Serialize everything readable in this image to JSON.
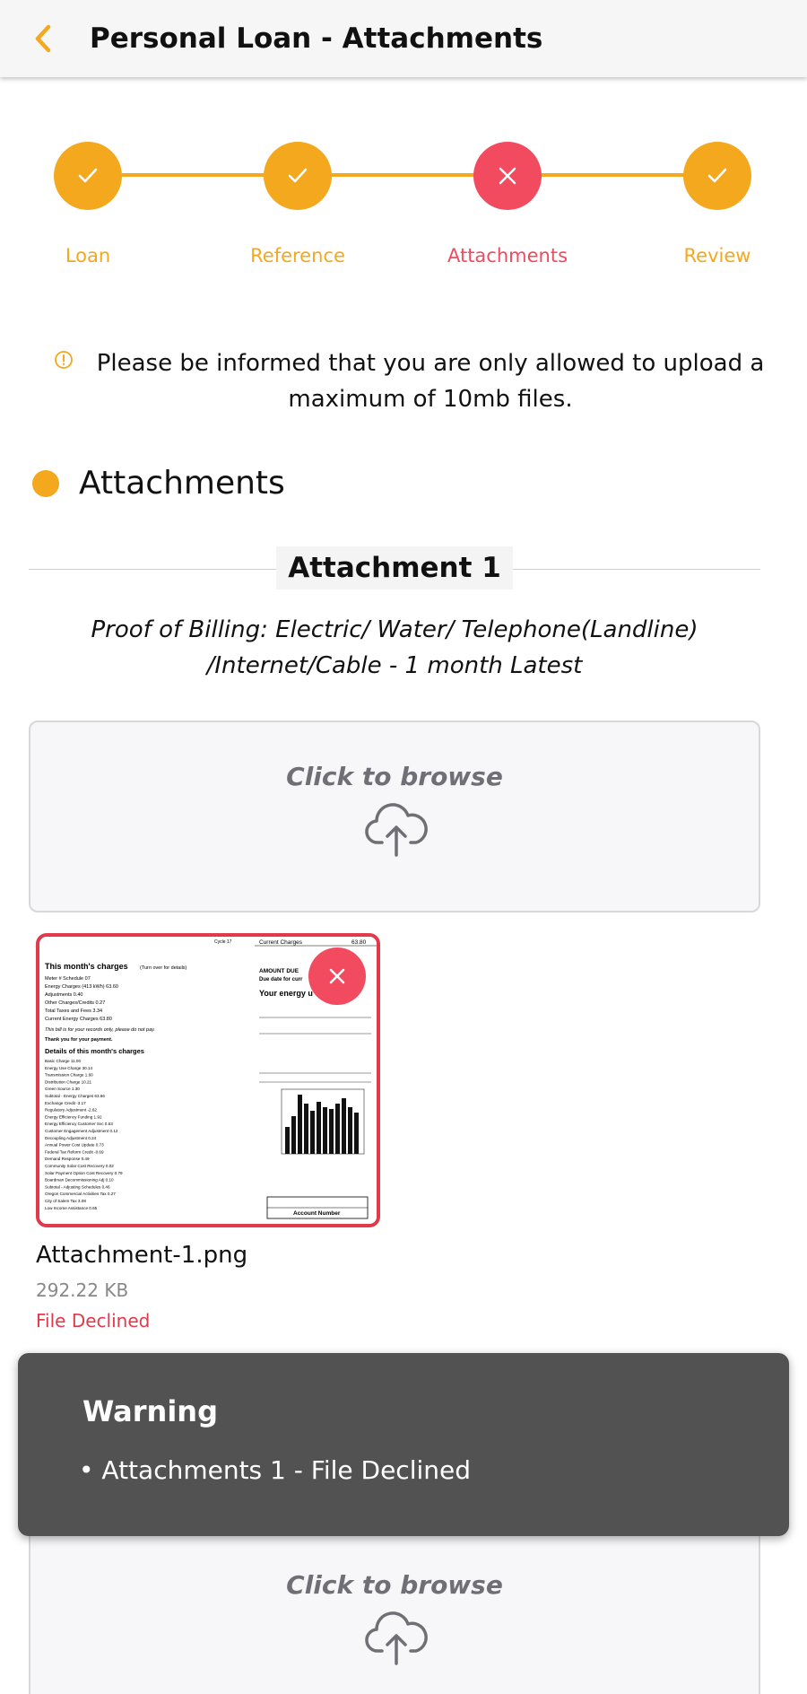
{
  "header": {
    "title": "Personal Loan - Attachments",
    "back_icon": "chevron-left-icon",
    "accent_color": "#f4a81d"
  },
  "stepper": {
    "steps": [
      {
        "label": "Loan",
        "status": "complete",
        "icon": "check-icon"
      },
      {
        "label": "Reference",
        "status": "complete",
        "icon": "check-icon"
      },
      {
        "label": "Attachments",
        "status": "error",
        "icon": "x-icon"
      },
      {
        "label": "Review",
        "status": "complete",
        "icon": "check-icon"
      }
    ],
    "complete_color": "#f4a81d",
    "error_color": "#f24a5e"
  },
  "notice": {
    "icon": "info-circle-icon",
    "text": "Please be informed that you are only allowed to upload a maximum of 10mb files."
  },
  "section": {
    "title": "Attachments"
  },
  "attachments": [
    {
      "heading": "Attachment 1",
      "description": "Proof of Billing: Electric/ Water/ Telephone(Landline) /Internet/Cable - 1 month Latest",
      "upload_label": "Click to browse",
      "upload_icon": "cloud-upload-icon",
      "file": {
        "name": "Attachment-1.png",
        "size": "292.22 KB",
        "status": "File Declined",
        "remove_icon": "close-icon"
      }
    }
  ],
  "second_upload": {
    "upload_label": "Click to browse",
    "upload_icon": "cloud-upload-icon"
  },
  "toast": {
    "title": "Warning",
    "items": [
      "• Attachments 1 - File Declined"
    ]
  },
  "bill_preview": {
    "charges_title": "This month's charges",
    "turn_over": "(Turn over for details)",
    "current_charges": "Current Charges",
    "current_amount": "63.80",
    "amount_due": "AMOUNT DUE",
    "due_date": "Due date for curr",
    "energy_use": "Your energy u",
    "details_title": "Details of this month's charges",
    "account_number": "Account Number",
    "thanks": "Thank you for your payment.",
    "records": "This bill is for your records only, please do not pay.",
    "lines": [
      "Meter #            Schedule 07",
      "Energy Charges (413 kWh)           63.60",
      "Adjustments                         0.40",
      "Other Charges/Credits               0.27",
      "Total Taxes and Fees                3.34",
      "Current Energy Charges             63.80"
    ],
    "detail_lines": [
      "Basic Charge                      11.00",
      "Energy Use Charge                 30.14",
      "Transmission Charge                1.60",
      "Distribution Charge               10.21",
      "Green Source                       1.30",
      "Subtotal - Energy Charges         63.66",
      "Exchange Credit                   -3.17",
      "Regulatory Adjustment             -2.62",
      "Energy Efficiency Funding          1.92",
      "Energy Efficiency Customer Svc     0.63",
      "Customer Engagement Adjustment     0.12",
      "Decoupling Adjustment              0.24",
      "Annual Power Cost Update           0.73",
      "Federal Tax Reform Credit         -0.69",
      "Demand Response                    0.49",
      "Community Solar Cost Recovery      0.02",
      "Solar Payment Option Cost Recovery 0.79",
      "Boardman Decommissioning Adj       0.10",
      "Subtotal - Adjusting Schedules     0.46",
      "Oregon Commercial Activities Tax   0.27",
      "City of Salem Tax                  3.08",
      "Low Income Assistance              0.65"
    ]
  }
}
